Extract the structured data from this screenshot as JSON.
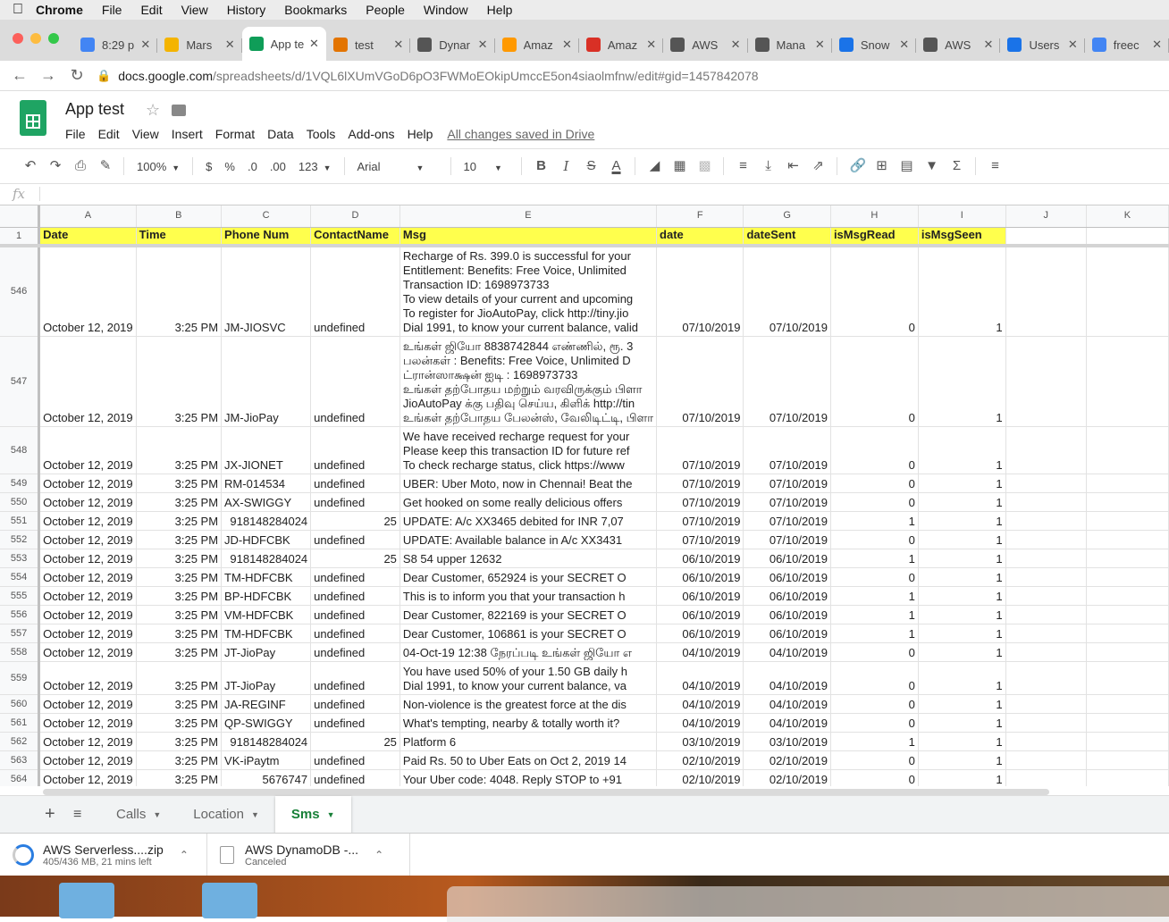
{
  "menubar": {
    "app": "Chrome",
    "items": [
      "File",
      "Edit",
      "View",
      "History",
      "Bookmarks",
      "People",
      "Window",
      "Help"
    ]
  },
  "browser_tabs": [
    {
      "label": "8:29 p",
      "icon": "docs-icon",
      "color": "#4285f4"
    },
    {
      "label": "Mars",
      "icon": "drive-icon",
      "color": "#f4b400"
    },
    {
      "label": "App te",
      "icon": "sheets-icon",
      "color": "#0f9d58",
      "active": true
    },
    {
      "label": "test",
      "icon": "chart-icon",
      "color": "#e37400"
    },
    {
      "label": "Dynar",
      "icon": "dynamo-icon",
      "color": "#555555"
    },
    {
      "label": "Amaz",
      "icon": "aws-icon",
      "color": "#f90"
    },
    {
      "label": "Amaz",
      "icon": "gmail-icon",
      "color": "#d93025"
    },
    {
      "label": "AWS",
      "icon": "globe-icon",
      "color": "#555555"
    },
    {
      "label": "Mana",
      "icon": "globe-icon",
      "color": "#555555"
    },
    {
      "label": "Snow",
      "icon": "snow-icon",
      "color": "#1a73e8"
    },
    {
      "label": "AWS",
      "icon": "globe-icon",
      "color": "#555555"
    },
    {
      "label": "Users",
      "icon": "cognito-icon",
      "color": "#1a73e8"
    },
    {
      "label": "freec",
      "icon": "google-icon",
      "color": "#4285f4"
    }
  ],
  "address": {
    "host": "docs.google.com",
    "path": "/spreadsheets/d/1VQL6lXUmVGoD6pO3FWMoEOkipUmccE5on4siaolmfnw/edit#gid=1457842078"
  },
  "doc": {
    "title": "App test",
    "menu": [
      "File",
      "Edit",
      "View",
      "Insert",
      "Format",
      "Data",
      "Tools",
      "Add-ons",
      "Help"
    ],
    "save_status": "All changes saved in Drive"
  },
  "toolbar": {
    "zoom": "100%",
    "currency": "$",
    "percent": "%",
    "decrease_decimal": ".0",
    "increase_decimal": ".00",
    "more_formats": "123",
    "font": "Arial",
    "font_size": "10"
  },
  "formula_bar": {
    "fx": "fx"
  },
  "columns": [
    "A",
    "B",
    "C",
    "D",
    "E",
    "F",
    "G",
    "H",
    "I",
    "J",
    "K"
  ],
  "header_row": {
    "row_num": "1",
    "cells": [
      "Date",
      "Time",
      "Phone Num",
      "ContactName",
      "Msg",
      "date",
      "dateSent",
      "isMsgRead",
      "isMsgSeen"
    ]
  },
  "rows": [
    {
      "n": "546",
      "date": "October 12, 2019",
      "time": "3:25 PM",
      "phone": "JM-JIOSVC",
      "contact": "undefined",
      "msg": [
        "Recharge of Rs. 399.0 is successful for your",
        "Entitlement: Benefits: Free Voice, Unlimited",
        "Transaction ID: 1698973733",
        "To view details of your current and upcoming",
        "To register for JioAutoPay, click http://tiny.jio",
        "Dial 1991, to know your current balance, valid"
      ],
      "d": "07/10/2019",
      "sent": "07/10/2019",
      "read": "0",
      "seen": "1"
    },
    {
      "n": "547",
      "date": "October 12, 2019",
      "time": "3:25 PM",
      "phone": "JM-JioPay",
      "contact": "undefined",
      "msg": [
        "உங்கள் ஜியோ 8838742844 எண்ணில், ரூ. 3",
        "பலன்கள் : Benefits: Free Voice, Unlimited D",
        "ட்ரான்ஸாக்ஷன் ஐடி : 1698973733",
        "உங்கள் தற்போதய மற்றும் வரவிருக்கும் பிளா",
        "JioAutoPay க்கு பதிவு செய்ய, கிளிக் http://tin",
        "உங்கள் தற்போதய பேலன்ஸ், வேலிடிட்டி, பிளா"
      ],
      "d": "07/10/2019",
      "sent": "07/10/2019",
      "read": "0",
      "seen": "1"
    },
    {
      "n": "548",
      "date": "October 12, 2019",
      "time": "3:25 PM",
      "phone": "JX-JIONET",
      "contact": "undefined",
      "msg": [
        "We have received recharge request for your",
        "Please keep this transaction ID for future ref",
        "To check recharge status, click https://www"
      ],
      "d": "07/10/2019",
      "sent": "07/10/2019",
      "read": "0",
      "seen": "1"
    },
    {
      "n": "549",
      "date": "October 12, 2019",
      "time": "3:25 PM",
      "phone": "RM-014534",
      "contact": "undefined",
      "msg": [
        "UBER: Uber Moto, now in Chennai! Beat the"
      ],
      "d": "07/10/2019",
      "sent": "07/10/2019",
      "read": "0",
      "seen": "1"
    },
    {
      "n": "550",
      "date": "October 12, 2019",
      "time": "3:25 PM",
      "phone": "AX-SWIGGY",
      "contact": "undefined",
      "msg": [
        "Get hooked on some really delicious offers"
      ],
      "d": "07/10/2019",
      "sent": "07/10/2019",
      "read": "0",
      "seen": "1"
    },
    {
      "n": "551",
      "date": "October 12, 2019",
      "time": "3:25 PM",
      "phone": "918148284024",
      "contact": "25",
      "msg": [
        "UPDATE: A/c XX3465 debited for INR 7,07"
      ],
      "d": "07/10/2019",
      "sent": "07/10/2019",
      "read": "1",
      "seen": "1"
    },
    {
      "n": "552",
      "date": "October 12, 2019",
      "time": "3:25 PM",
      "phone": "JD-HDFCBK",
      "contact": "undefined",
      "msg": [
        "UPDATE: Available balance in A/c XX3431"
      ],
      "d": "07/10/2019",
      "sent": "07/10/2019",
      "read": "0",
      "seen": "1"
    },
    {
      "n": "553",
      "date": "October 12, 2019",
      "time": "3:25 PM",
      "phone": "918148284024",
      "contact": "25",
      "msg": [
        "S8 54 upper 12632"
      ],
      "d": "06/10/2019",
      "sent": "06/10/2019",
      "read": "1",
      "seen": "1"
    },
    {
      "n": "554",
      "date": "October 12, 2019",
      "time": "3:25 PM",
      "phone": "TM-HDFCBK",
      "contact": "undefined",
      "msg": [
        "Dear Customer, 652924 is your SECRET O"
      ],
      "d": "06/10/2019",
      "sent": "06/10/2019",
      "read": "0",
      "seen": "1"
    },
    {
      "n": "555",
      "date": "October 12, 2019",
      "time": "3:25 PM",
      "phone": "BP-HDFCBK",
      "contact": "undefined",
      "msg": [
        "This is to inform you that your transaction h"
      ],
      "d": "06/10/2019",
      "sent": "06/10/2019",
      "read": "1",
      "seen": "1"
    },
    {
      "n": "556",
      "date": "October 12, 2019",
      "time": "3:25 PM",
      "phone": "VM-HDFCBK",
      "contact": "undefined",
      "msg": [
        "Dear Customer, 822169 is your SECRET O"
      ],
      "d": "06/10/2019",
      "sent": "06/10/2019",
      "read": "1",
      "seen": "1"
    },
    {
      "n": "557",
      "date": "October 12, 2019",
      "time": "3:25 PM",
      "phone": "TM-HDFCBK",
      "contact": "undefined",
      "msg": [
        "Dear Customer, 106861 is your SECRET O"
      ],
      "d": "06/10/2019",
      "sent": "06/10/2019",
      "read": "1",
      "seen": "1"
    },
    {
      "n": "558",
      "date": "October 12, 2019",
      "time": "3:25 PM",
      "phone": "JT-JioPay",
      "contact": "undefined",
      "msg": [
        "04-Oct-19 12:38 நேரப்படி உங்கள் ஜியோ எ"
      ],
      "d": "04/10/2019",
      "sent": "04/10/2019",
      "read": "0",
      "seen": "1"
    },
    {
      "n": "559",
      "date": "October 12, 2019",
      "time": "3:25 PM",
      "phone": "JT-JioPay",
      "contact": "undefined",
      "msg": [
        "You have used 50% of your 1.50 GB daily h",
        "Dial 1991, to know your current balance, va"
      ],
      "d": "04/10/2019",
      "sent": "04/10/2019",
      "read": "0",
      "seen": "1"
    },
    {
      "n": "560",
      "date": "October 12, 2019",
      "time": "3:25 PM",
      "phone": "JA-REGINF",
      "contact": "undefined",
      "msg": [
        "Non-violence is the greatest force at the dis"
      ],
      "d": "04/10/2019",
      "sent": "04/10/2019",
      "read": "0",
      "seen": "1"
    },
    {
      "n": "561",
      "date": "October 12, 2019",
      "time": "3:25 PM",
      "phone": "QP-SWIGGY",
      "contact": "undefined",
      "msg": [
        "What's tempting, nearby & totally worth it?"
      ],
      "d": "04/10/2019",
      "sent": "04/10/2019",
      "read": "0",
      "seen": "1"
    },
    {
      "n": "562",
      "date": "October 12, 2019",
      "time": "3:25 PM",
      "phone": "918148284024",
      "contact": "25",
      "msg": [
        "Platform 6"
      ],
      "d": "03/10/2019",
      "sent": "03/10/2019",
      "read": "1",
      "seen": "1"
    },
    {
      "n": "563",
      "date": "October 12, 2019",
      "time": "3:25 PM",
      "phone": "VK-iPaytm",
      "contact": "undefined",
      "msg": [
        "Paid Rs. 50 to Uber Eats on Oct 2, 2019 14"
      ],
      "d": "02/10/2019",
      "sent": "02/10/2019",
      "read": "0",
      "seen": "1"
    },
    {
      "n": "564",
      "date": "October 12, 2019",
      "time": "3:25 PM",
      "phone": "5676747",
      "contact": "undefined",
      "msg": [
        "Your Uber code: 4048. Reply STOP to +91"
      ],
      "d": "02/10/2019",
      "sent": "02/10/2019",
      "read": "0",
      "seen": "1"
    }
  ],
  "sheet_tabs": [
    {
      "label": "Calls"
    },
    {
      "label": "Location"
    },
    {
      "label": "Sms",
      "active": true
    }
  ],
  "downloads": [
    {
      "name": "AWS Serverless....zip",
      "status": "405/436 MB, 21 mins left"
    },
    {
      "name": "AWS DynamoDB -...",
      "status": "Canceled"
    }
  ],
  "colors": {
    "header_fill": "#ffff4d",
    "active_sheet": "#188038",
    "sheets_green": "#1fa463"
  }
}
